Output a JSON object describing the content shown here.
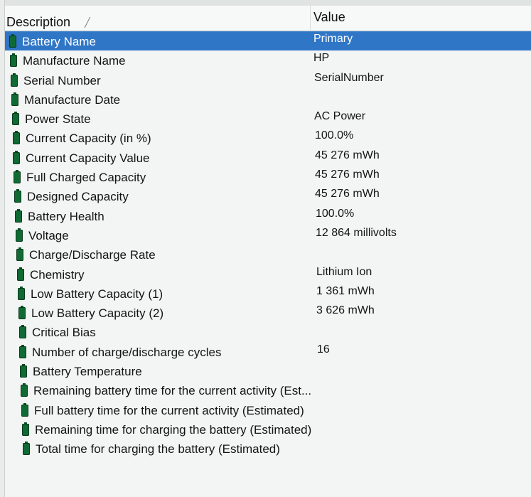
{
  "columns": {
    "description": "Description",
    "value": "Value"
  },
  "rows": [
    {
      "label": "Battery Name",
      "value": "Primary"
    },
    {
      "label": "Manufacture Name",
      "value": "HP"
    },
    {
      "label": "Serial Number",
      "value": "SerialNumber"
    },
    {
      "label": "Manufacture Date",
      "value": ""
    },
    {
      "label": "Power State",
      "value": "AC Power"
    },
    {
      "label": "Current Capacity (in %)",
      "value": "100.0%"
    },
    {
      "label": "Current Capacity Value",
      "value": "45 276 mWh"
    },
    {
      "label": "Full Charged Capacity",
      "value": "45 276 mWh"
    },
    {
      "label": "Designed Capacity",
      "value": "45 276 mWh"
    },
    {
      "label": "Battery Health",
      "value": "100.0%"
    },
    {
      "label": "Voltage",
      "value": "12 864 millivolts"
    },
    {
      "label": "Charge/Discharge Rate",
      "value": ""
    },
    {
      "label": "Chemistry",
      "value": "Lithium Ion"
    },
    {
      "label": "Low Battery Capacity (1)",
      "value": "1 361 mWh"
    },
    {
      "label": "Low Battery Capacity (2)",
      "value": "3 626 mWh"
    },
    {
      "label": "Critical Bias",
      "value": ""
    },
    {
      "label": "Number of charge/discharge cycles",
      "value": "16"
    },
    {
      "label": "Battery Temperature",
      "value": ""
    },
    {
      "label": "Remaining battery time for the current activity (Est...",
      "value": ""
    },
    {
      "label": "Full battery time for the current activity (Estimated)",
      "value": ""
    },
    {
      "label": "Remaining time for charging the battery (Estimated)",
      "value": ""
    },
    {
      "label": "Total  time for charging the battery (Estimated)",
      "value": ""
    }
  ],
  "selected_row": 0,
  "icons": {
    "row_icon": "battery-icon",
    "sort_icon": "sort-indicator-icon"
  },
  "colors": {
    "selection": "#2f76c7",
    "battery_icon": "#0f6a33"
  }
}
